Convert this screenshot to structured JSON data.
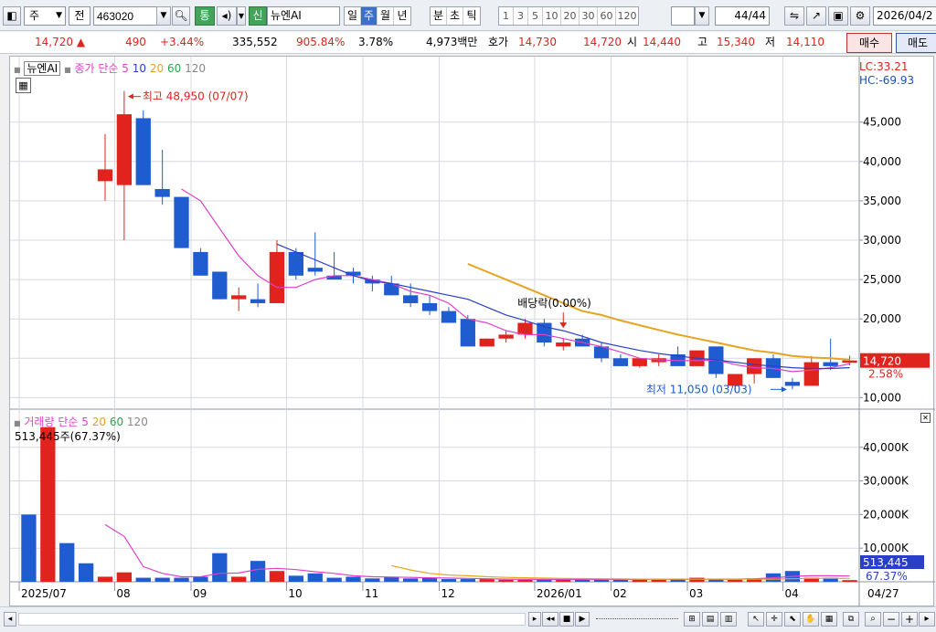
{
  "toolbar": {
    "mode_label": "주",
    "prev_label": "전",
    "code_value": "463020",
    "market_badge": "통",
    "credit_badge": "신",
    "stock_name": "뉴엔AI",
    "period_tabs": [
      "일",
      "주",
      "월",
      "년",
      "분",
      "초",
      "틱"
    ],
    "active_period": "주",
    "interval_buttons": [
      "1",
      "3",
      "5",
      "10",
      "20",
      "30",
      "60",
      "120"
    ],
    "count_value": "44",
    "count_total": "/44",
    "date_value": "2026/04/2"
  },
  "quote": {
    "price": "14,720",
    "change": "490",
    "change_pct": "+3.44%",
    "volume": "335,552",
    "volume_ratio": "905.84%",
    "turnover": "3.78%",
    "trade_value": "4,973백만",
    "ask_label": "호가",
    "ask": "14,730",
    "bid": "14,720",
    "open_label": "시",
    "open": "14,440",
    "high_label": "고",
    "high": "15,340",
    "low_label": "저",
    "low": "14,110",
    "buy_label": "매수",
    "sell_label": "매도"
  },
  "price_panel": {
    "legend_name": "뉴엔AI",
    "legend_ma_label": "종가 단순",
    "legend_ma": [
      "5",
      "10",
      "20",
      "60",
      "120"
    ],
    "high_annotation": "최고 48,950 (07/07)",
    "low_annotation": "최저 11,050 (03/03)",
    "dividend_annotation": "배당락(0.00%)",
    "lc_label": "LC:33.21",
    "hc_label": "HC:-69.93",
    "current_price_tag": "14,720",
    "current_pct_tag": "2.58%",
    "y_ticks": [
      "45,000",
      "40,000",
      "35,000",
      "30,000",
      "25,000",
      "20,000",
      "15,000",
      "10,000"
    ]
  },
  "volume_panel": {
    "legend_label": "거래량 단순",
    "legend_ma": [
      "5",
      "20",
      "60",
      "120"
    ],
    "vol_annotation": "513,445주(67.37%)",
    "current_vol_tag": "513,445",
    "current_vol_pct_tag": "67.37%",
    "y_ticks": [
      "40,000K",
      "30,000K",
      "20,000K",
      "10,000K"
    ]
  },
  "x_labels": [
    "2025/07",
    "08",
    "09",
    "10",
    "11",
    "12",
    "2026/01",
    "02",
    "03",
    "04",
    "04/27"
  ],
  "colors": {
    "up": "#e0231c",
    "down": "#1f5ccf",
    "ma5": "#e040c8",
    "ma10": "#2a3fc8",
    "ma20": "#e8a320",
    "accent": "#3c70c8"
  },
  "chart_data": [
    {
      "type": "candlestick",
      "title": "",
      "xlabel": "",
      "ylabel": "",
      "x": [
        "2025/07 w1",
        "w2",
        "w3",
        "w4",
        "2025/08 w1",
        "w2",
        "w3",
        "w4",
        "2025/09 w1",
        "w2",
        "w3",
        "w4",
        "2025/10 w1",
        "w2",
        "w3",
        "w4",
        "2025/11 w1",
        "w2",
        "w3",
        "w4",
        "2025/12 w1",
        "w2",
        "w3",
        "w4",
        "2026/01 w1",
        "w2",
        "w3",
        "w4",
        "2026/02 w1",
        "w2",
        "w3",
        "w4",
        "2026/03 w1",
        "w2",
        "w3",
        "w4",
        "2026/04 w1",
        "w2",
        "w3",
        "w4"
      ],
      "ohlc": [
        [
          37500,
          43500,
          35000,
          39000
        ],
        [
          37000,
          48950,
          30000,
          46000
        ],
        [
          45500,
          46500,
          37000,
          37000
        ],
        [
          36500,
          41500,
          34500,
          35500
        ],
        [
          35500,
          35500,
          29000,
          29000
        ],
        [
          28500,
          29000,
          25500,
          25500
        ],
        [
          26000,
          26000,
          22500,
          22500
        ],
        [
          22500,
          24000,
          21000,
          23000
        ],
        [
          22500,
          24500,
          21500,
          22000
        ],
        [
          22000,
          30000,
          22000,
          28500
        ],
        [
          28500,
          29000,
          25000,
          25500
        ],
        [
          26500,
          31000,
          25500,
          26000
        ],
        [
          25500,
          28500,
          25000,
          25000
        ],
        [
          26000,
          26500,
          24500,
          25500
        ],
        [
          25000,
          25500,
          23500,
          24500
        ],
        [
          24500,
          25500,
          23000,
          23000
        ],
        [
          23000,
          24500,
          21500,
          22000
        ],
        [
          22000,
          23000,
          20500,
          21000
        ],
        [
          21000,
          21500,
          19500,
          19500
        ],
        [
          20000,
          20500,
          16500,
          16500
        ],
        [
          16500,
          17500,
          16500,
          17500
        ],
        [
          17500,
          18500,
          17000,
          18000
        ],
        [
          18000,
          20000,
          17500,
          19500
        ],
        [
          19500,
          20000,
          16500,
          17000
        ],
        [
          16500,
          17500,
          16000,
          17000
        ],
        [
          17500,
          18000,
          16500,
          16500
        ],
        [
          16500,
          17000,
          14500,
          15000
        ],
        [
          15000,
          15500,
          14000,
          14000
        ],
        [
          14000,
          15000,
          13800,
          15000
        ],
        [
          14500,
          15500,
          14000,
          15000
        ],
        [
          15500,
          16500,
          14000,
          14000
        ],
        [
          14000,
          16000,
          14000,
          16000
        ],
        [
          16500,
          16500,
          12500,
          13000
        ],
        [
          11500,
          13000,
          10800,
          13000
        ],
        [
          13000,
          15000,
          11800,
          15000
        ],
        [
          15000,
          15500,
          12500,
          12500
        ],
        [
          12000,
          12500,
          11050,
          11500
        ],
        [
          11500,
          15300,
          11500,
          14500
        ],
        [
          14500,
          17500,
          13500,
          14000
        ],
        [
          14440,
          15340,
          14110,
          14720
        ]
      ],
      "series": [
        {
          "name": "5",
          "values": [
            null,
            null,
            null,
            null,
            36500,
            35000,
            31500,
            28000,
            25500,
            24000,
            24000,
            25000,
            25500,
            25500,
            25000,
            24500,
            23500,
            23000,
            22000,
            20000,
            19500,
            18500,
            18000,
            18000,
            17500,
            17000,
            16500,
            15800,
            15000,
            14800,
            14700,
            14700,
            14800,
            14200,
            13800,
            13700,
            13300,
            13500,
            13800,
            14300
          ]
        },
        {
          "name": "10",
          "values": [
            null,
            null,
            null,
            null,
            null,
            null,
            null,
            null,
            null,
            29500,
            28500,
            27500,
            26500,
            25500,
            24800,
            24500,
            24000,
            23500,
            23000,
            22500,
            21500,
            20500,
            19800,
            19000,
            18500,
            17800,
            17000,
            16500,
            16000,
            15600,
            15300,
            15000,
            14800,
            14500,
            14200,
            14000,
            13800,
            13700,
            13700,
            13800
          ]
        },
        {
          "name": "20",
          "values": [
            null,
            null,
            null,
            null,
            null,
            null,
            null,
            null,
            null,
            null,
            null,
            null,
            null,
            null,
            null,
            null,
            null,
            null,
            null,
            27000,
            26000,
            25000,
            24000,
            23000,
            22000,
            21000,
            20500,
            19800,
            19200,
            18600,
            18000,
            17500,
            17000,
            16500,
            16000,
            15700,
            15300,
            15100,
            15000,
            14800
          ]
        }
      ],
      "ylim": [
        9000,
        51000
      ]
    },
    {
      "type": "bar",
      "title": "",
      "xlabel": "",
      "ylabel": "",
      "unit": "K",
      "values": [
        20000,
        46000,
        11500,
        5500,
        1500,
        2800,
        1200,
        1200,
        1200,
        1500,
        8500,
        1500,
        6200,
        3200,
        1800,
        2500,
        1200,
        1500,
        1000,
        1500,
        1000,
        1200,
        800,
        800,
        800,
        600,
        600,
        800,
        600,
        1000,
        600,
        600,
        800,
        600,
        800,
        1200,
        800,
        600,
        1000,
        2500,
        3200,
        1200,
        1200,
        500
      ],
      "ma5": [
        null,
        null,
        null,
        null,
        17000,
        13500,
        4500,
        2500,
        1500,
        1500,
        2500,
        2600,
        3700,
        4000,
        3600,
        3000,
        2500,
        1800,
        1500,
        1400,
        1300,
        1200,
        1100,
        1000,
        900,
        800,
        700,
        700,
        700,
        700,
        700,
        700,
        700,
        800,
        800,
        800,
        800,
        800,
        900,
        1200,
        1600,
        1800,
        1800,
        1700
      ],
      "ma20": [
        null,
        null,
        null,
        null,
        null,
        null,
        null,
        null,
        null,
        null,
        null,
        null,
        null,
        null,
        null,
        null,
        null,
        null,
        null,
        4800,
        3500,
        2500,
        2000,
        1800,
        1500,
        1300,
        1200,
        1100,
        1000,
        950,
        900,
        850,
        800,
        800,
        750,
        750,
        750,
        750,
        750,
        800,
        900,
        1000,
        1000,
        1000
      ],
      "ylim": [
        0,
        47000
      ]
    }
  ]
}
